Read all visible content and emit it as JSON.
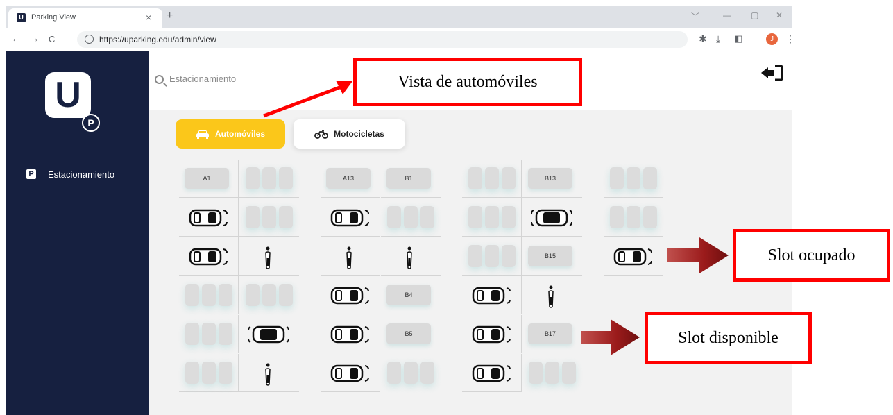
{
  "browser": {
    "tab_title": "Parking View",
    "favicon_letter": "U",
    "tab_close": "×",
    "new_tab": "+",
    "url": "https://uparking.edu/admin/view",
    "avatar_initial": "J",
    "window_controls": [
      "﹀",
      "—",
      "▢",
      "✕"
    ],
    "nav": [
      "←",
      "→",
      "C"
    ]
  },
  "sidebar": {
    "logo_letter": "U",
    "logo_sub": "P",
    "items": [
      {
        "icon": "P",
        "label": "Estacionamiento"
      }
    ],
    "background": "#162040"
  },
  "search": {
    "placeholder": "Estacionamiento"
  },
  "vehicle_tabs": [
    {
      "label": "Automóviles",
      "active": true,
      "color": "#fbc71a"
    },
    {
      "label": "Motocicletas",
      "active": false
    }
  ],
  "slots": [
    {
      "label": "A1"
    },
    {
      "label": "A13"
    },
    {
      "label": "B1"
    },
    {
      "label": "B13"
    },
    {
      "label": "B15"
    },
    {
      "label": "B4"
    },
    {
      "label": "B5"
    },
    {
      "label": "B17"
    }
  ],
  "annotations": {
    "cars_view": "Vista de automóviles",
    "occupied": "Slot ocupado",
    "available": "Slot disponible",
    "box_color": "#ff0000"
  }
}
